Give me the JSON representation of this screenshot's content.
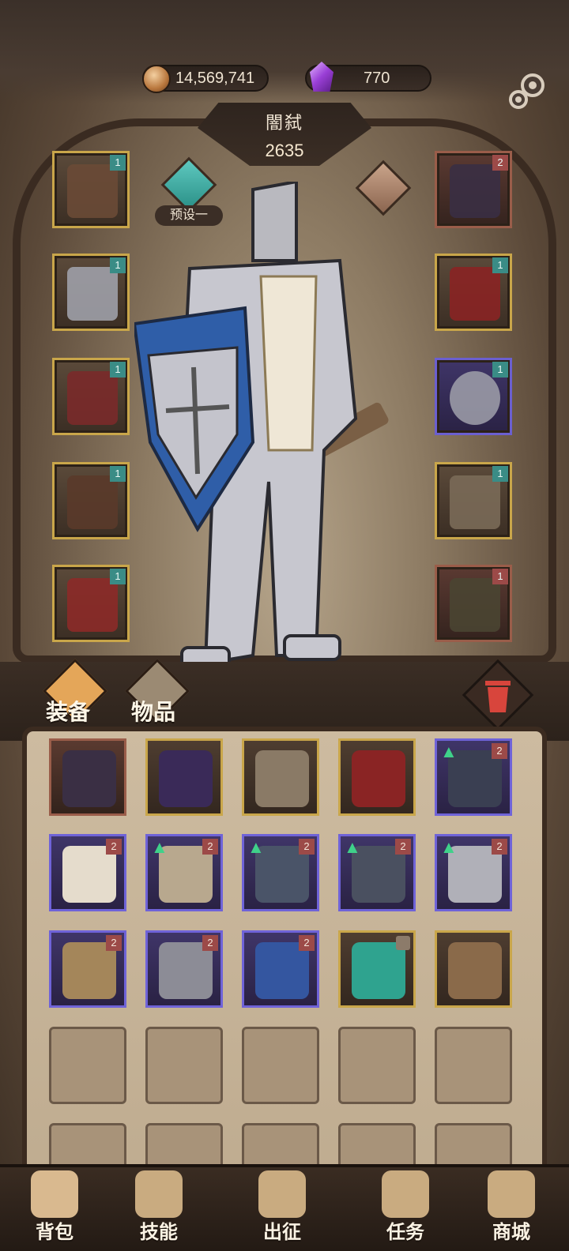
{
  "currency": {
    "coins": "14,569,741",
    "gems": "770"
  },
  "character": {
    "name": "闇弑",
    "power": "2635"
  },
  "preset": {
    "label": "预设一"
  },
  "tabs": {
    "equip": "装备",
    "items": "物品"
  },
  "equipped_left": [
    {
      "tier": "1",
      "rarity": "gold",
      "icon": "helmet-icon"
    },
    {
      "tier": "1",
      "rarity": "gold",
      "icon": "chest-armor-icon"
    },
    {
      "tier": "1",
      "rarity": "gold",
      "icon": "gauntlet-icon"
    },
    {
      "tier": "1",
      "rarity": "gold",
      "icon": "leg-armor-icon"
    },
    {
      "tier": "1",
      "rarity": "gold",
      "icon": "boots-icon"
    }
  ],
  "equipped_right": [
    {
      "tier": "2",
      "rarity": "red",
      "icon": "necklace-icon"
    },
    {
      "tier": "1",
      "rarity": "gold",
      "icon": "shoulder-armor-icon"
    },
    {
      "tier": "1",
      "rarity": "purple",
      "icon": "ring-icon"
    },
    {
      "tier": "1",
      "rarity": "gold",
      "icon": "spear-icon"
    },
    {
      "tier": "1",
      "rarity": "red",
      "icon": "cloak-icon"
    }
  ],
  "inventory": [
    {
      "rarity": "red",
      "tier": "",
      "up": false,
      "icon": "necklace-icon"
    },
    {
      "rarity": "gold",
      "tier": "",
      "up": false,
      "icon": "belt-icon"
    },
    {
      "rarity": "gold",
      "tier": "",
      "up": false,
      "icon": "skull-mask-icon"
    },
    {
      "rarity": "gold",
      "tier": "",
      "up": false,
      "icon": "shoulder-armor-icon"
    },
    {
      "rarity": "purple",
      "tier": "2",
      "up": true,
      "icon": "cap-icon"
    },
    {
      "rarity": "purple",
      "tier": "2",
      "up": false,
      "icon": "shirt-icon"
    },
    {
      "rarity": "purple",
      "tier": "2",
      "up": true,
      "icon": "bracer-icon"
    },
    {
      "rarity": "purple",
      "tier": "2",
      "up": true,
      "icon": "leg-armor-icon"
    },
    {
      "rarity": "purple",
      "tier": "2",
      "up": true,
      "icon": "boots-icon"
    },
    {
      "rarity": "purple",
      "tier": "2",
      "up": true,
      "icon": "dagger-icon"
    },
    {
      "rarity": "purple",
      "tier": "2",
      "up": false,
      "icon": "helmet-icon"
    },
    {
      "rarity": "purple",
      "tier": "2",
      "up": false,
      "icon": "ring-icon"
    },
    {
      "rarity": "purple",
      "tier": "2",
      "up": false,
      "icon": "tome-icon"
    },
    {
      "rarity": "gold",
      "tier": "",
      "up": false,
      "locked": true,
      "icon": "amulet-icon"
    },
    {
      "rarity": "gold",
      "tier": "",
      "up": false,
      "icon": "shield-icon"
    }
  ],
  "nav": [
    {
      "label": "背包",
      "icon": "backpack-icon"
    },
    {
      "label": "技能",
      "icon": "skills-icon"
    },
    {
      "label": "出征",
      "icon": "battle-icon"
    },
    {
      "label": "任务",
      "icon": "quest-icon"
    },
    {
      "label": "商城",
      "icon": "shop-icon"
    }
  ],
  "colors": {
    "gold": "#c9a64a",
    "red": "#9a5d4a",
    "purple": "#6b5fd0",
    "teal": "#3a8c86"
  }
}
